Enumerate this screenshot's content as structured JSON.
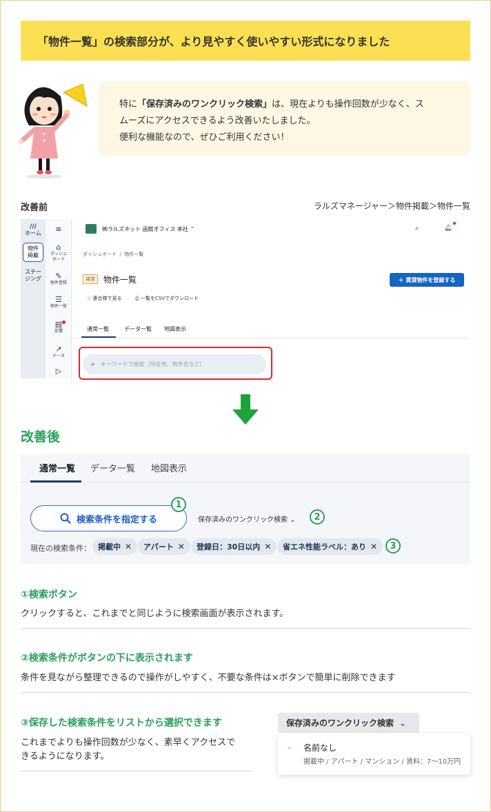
{
  "headline": "「物件一覧」の検索部分が、より見やすく使いやすい形式になりました",
  "speech": {
    "prefix": "特に",
    "bold": "「保存済みのワンクリック検索」",
    "line1_rest": "は、現在よりも操作回数が少なく、ス",
    "line2": "ムーズにアクセスできるよう改善いたしました。",
    "line3": "便利な機能なので、ぜひご利用ください！"
  },
  "before": {
    "label": "改善前",
    "breadcrumb": "ラルズマネージャー＞物件掲載＞物件一覧",
    "rail": [
      {
        "icon": "///",
        "label": "ホーム"
      },
      {
        "label": "物件\n掲載"
      },
      {
        "label": "ステー\nジング"
      }
    ],
    "sub": [
      {
        "icon": "≡",
        "label": ""
      },
      {
        "icon": "⌂",
        "label": "ダッシュ\nボード"
      },
      {
        "icon": "✎",
        "label": "物件登録"
      },
      {
        "icon": "☰",
        "label": "物件一覧"
      },
      {
        "icon": "▤",
        "label": "反響"
      },
      {
        "icon": "↗",
        "label": "データ"
      },
      {
        "icon": "▷",
        "label": ""
      }
    ],
    "company": "㈱ラルズネット 函館オフィス 本社",
    "page_breadcrumb": "ダッシュボード  /  物件一覧",
    "type_badge": "賃貸",
    "page_title": "物件一覧",
    "register_button": "＋ 賃貸物件を登録する",
    "link_contacts": "☆ 連合隊で見る",
    "link_csv": "一覧をCSVでダウンロード",
    "tabs": [
      "通常一覧",
      "データ一覧",
      "地図表示"
    ],
    "search_placeholder": "キーワードで検索（所在地、物件名など）",
    "avatar": "不"
  },
  "after": {
    "label": "改善後",
    "tabs": [
      "通常一覧",
      "データ一覧",
      "地図表示"
    ],
    "condition_button": "検索条件を指定する",
    "saved_search": "保存済みのワンクリック検索",
    "current_conditions_label": "現在の検索条件：",
    "chips": [
      "掲載中",
      "アパート",
      "登録日：30日以内",
      "省エネ性能ラベル：あり"
    ],
    "num1": "1",
    "num2": "2",
    "num3": "3"
  },
  "sections": [
    {
      "title": "①検索ボタン",
      "text": "クリックすると、これまでと同じように検索画面が表示されます。"
    },
    {
      "title": "②検索条件がボタンの下に表示されます",
      "text": "条件を見ながら整理できるので操作がしやすく、不要な条件は×ボタンで簡単に削除できます"
    },
    {
      "title": "③保存した検索条件をリストから選択できます",
      "text1": "これまでよりも操作回数が少なく、素早くアクセスで",
      "text2": "きるようになります。"
    }
  ],
  "dropdown_demo": {
    "button": "保存済みのワンクリック検索",
    "item_name": "名前なし",
    "item_detail": "掲載中 / アパート / マンション / 賃料：7〜10万円"
  },
  "colors": {
    "accent_green": "#2aa05a",
    "headline_yellow": "#fbe053",
    "brand_blue": "#1565c0",
    "alert_red": "#e3242b"
  }
}
